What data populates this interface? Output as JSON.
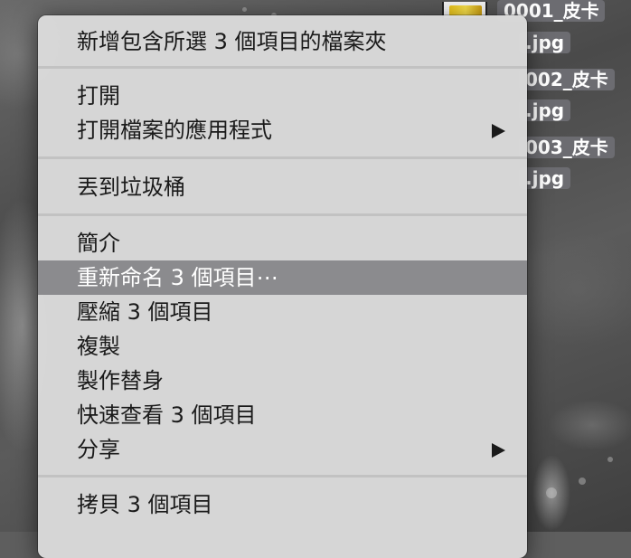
{
  "desktop": {
    "files": [
      {
        "name_line1": "0001_皮卡",
        "name_line2": ".jpg"
      },
      {
        "name_line1": "002_皮卡",
        "name_line2": ".jpg"
      },
      {
        "name_line1": "003_皮卡",
        "name_line2": ".jpg"
      }
    ]
  },
  "menu": {
    "new_folder": "新增包含所選 3 個項目的檔案夾",
    "open": "打開",
    "open_with": "打開檔案的應用程式",
    "trash": "丟到垃圾桶",
    "get_info": "簡介",
    "rename": "重新命名 3 個項目⋯",
    "compress": "壓縮 3 個項目",
    "duplicate": "複製",
    "make_alias": "製作替身",
    "quick_look": "快速查看 3 個項目",
    "share": "分享",
    "copy": "拷貝 3 個項目"
  },
  "colors": {
    "highlight": "#8b8b8e",
    "menu_background": "#d8d8d8"
  }
}
